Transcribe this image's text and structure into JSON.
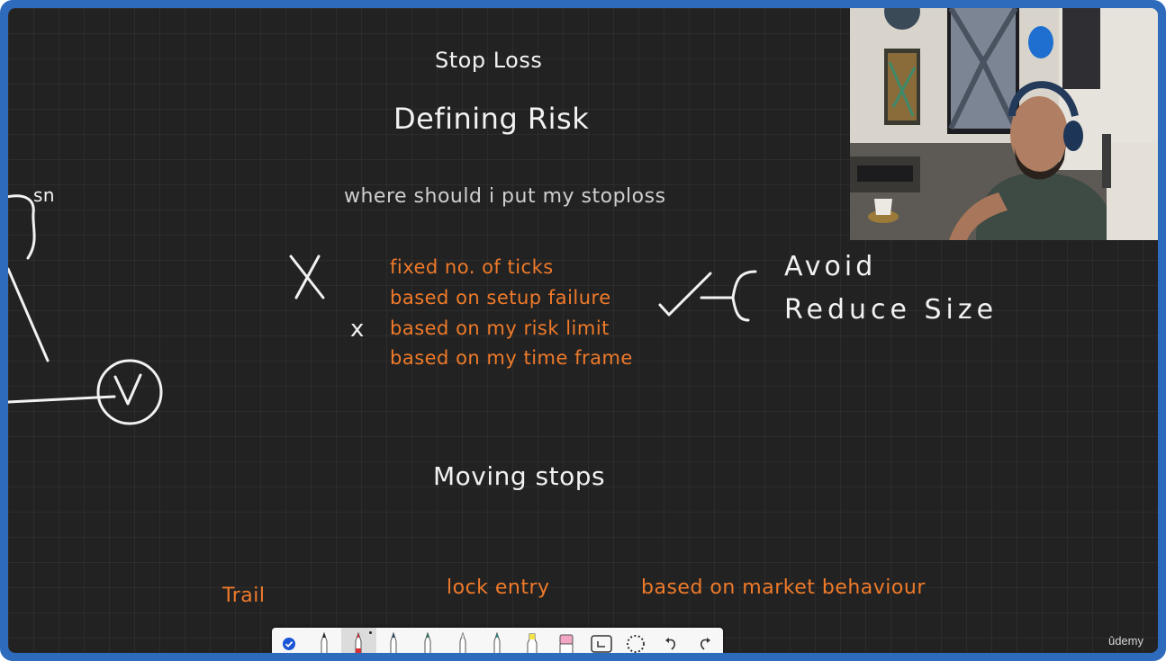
{
  "board": {
    "heading_small": "Stop Loss",
    "heading_main": "Defining Risk",
    "question": "where should i put my stoploss",
    "options": [
      "fixed no. of ticks",
      "based on setup failure",
      "based on my risk limit",
      "based on my time frame"
    ],
    "marks": {
      "big_x": "X",
      "small_x": "x",
      "check": "✓"
    },
    "side_notes": {
      "avoid": "Avoid",
      "reduce_size": "Reduce Size"
    },
    "margin_scribble": "sn",
    "section2_title": "Moving stops",
    "moving_options": [
      "Trail",
      "lock entry",
      "based on market behaviour"
    ]
  },
  "toolbar": {
    "tools": [
      {
        "name": "lasso-select-tool",
        "icon": "check-circle-icon"
      },
      {
        "name": "black-pen-tool",
        "icon": "pen-icon",
        "color": "#1c1c1c"
      },
      {
        "name": "red-pen-tool",
        "icon": "pen-icon",
        "color": "#d93036",
        "selected": true
      },
      {
        "name": "dark-teal-pen-tool",
        "icon": "pen-icon",
        "color": "#1f4e6a"
      },
      {
        "name": "green-pen-tool",
        "icon": "pen-icon",
        "color": "#1f7a55"
      },
      {
        "name": "white-pen-tool",
        "icon": "pen-icon",
        "color": "#ffffff"
      },
      {
        "name": "teal-pen-tool",
        "icon": "pen-icon",
        "color": "#2f8a86"
      },
      {
        "name": "highlighter-tool",
        "icon": "highlighter-icon",
        "color": "#f0e24a"
      },
      {
        "name": "eraser-tool",
        "icon": "eraser-icon",
        "color": "#f2a6c4"
      },
      {
        "name": "crop-tool",
        "icon": "crop-icon"
      },
      {
        "name": "lasso-tool",
        "icon": "lasso-icon"
      },
      {
        "name": "undo-tool",
        "icon": "undo-icon"
      },
      {
        "name": "redo-tool",
        "icon": "redo-icon"
      }
    ]
  },
  "watermark": "ûdemy",
  "colors": {
    "frame": "#2f6bbd",
    "board": "#222222",
    "accent_orange": "#ef7a2a"
  }
}
